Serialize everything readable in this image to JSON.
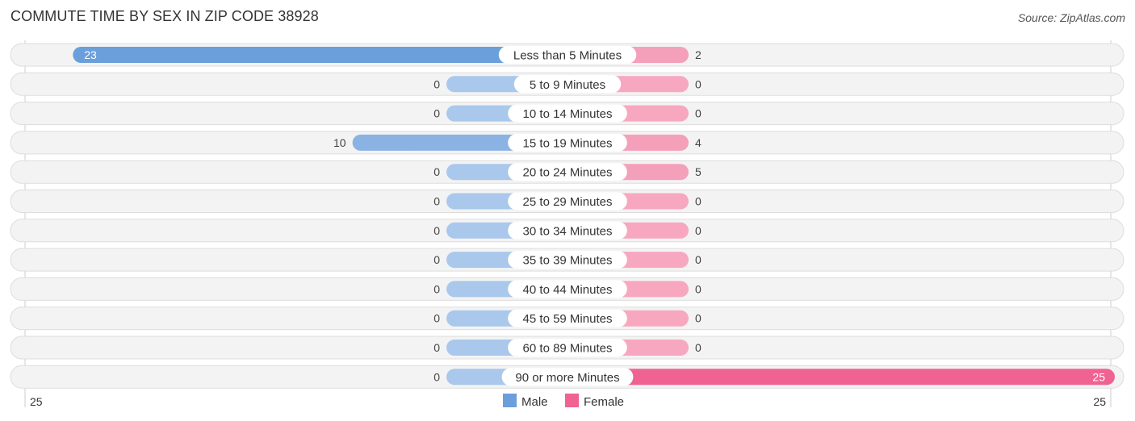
{
  "title": "COMMUTE TIME BY SEX IN ZIP CODE 38928",
  "source": "Source: ZipAtlas.com",
  "chart_data": {
    "type": "bar",
    "orientation": "horizontal-diverging",
    "title": "COMMUTE TIME BY SEX IN ZIP CODE 38928",
    "categories": [
      "Less than 5 Minutes",
      "5 to 9 Minutes",
      "10 to 14 Minutes",
      "15 to 19 Minutes",
      "20 to 24 Minutes",
      "25 to 29 Minutes",
      "30 to 34 Minutes",
      "35 to 39 Minutes",
      "40 to 44 Minutes",
      "45 to 59 Minutes",
      "60 to 89 Minutes",
      "90 or more Minutes"
    ],
    "series": [
      {
        "name": "Male",
        "color": "#6a9fdb",
        "values": [
          23,
          0,
          0,
          10,
          0,
          0,
          0,
          0,
          0,
          0,
          0,
          0
        ]
      },
      {
        "name": "Female",
        "color": "#f06292",
        "values": [
          2,
          0,
          0,
          4,
          5,
          0,
          0,
          0,
          0,
          0,
          0,
          25
        ]
      }
    ],
    "xlim": [
      25,
      25
    ],
    "axis_labels": {
      "left": "25",
      "right": "25"
    },
    "legend": {
      "position": "bottom-center",
      "items": [
        "Male",
        "Female"
      ]
    }
  }
}
